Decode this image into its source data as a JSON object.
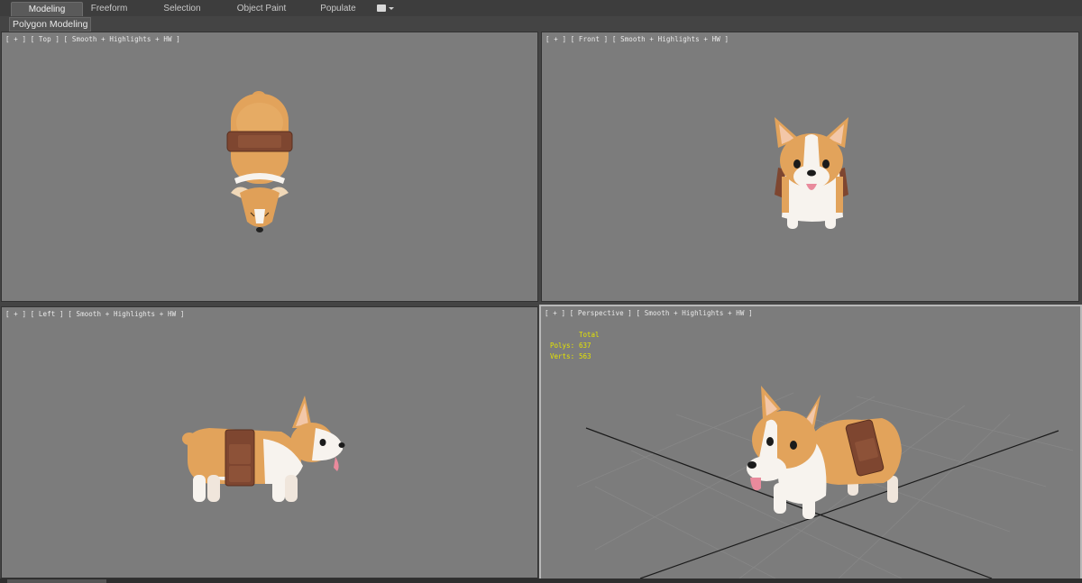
{
  "ribbon": {
    "tabs": [
      "Modeling",
      "Freeform",
      "Selection",
      "Object Paint",
      "Populate"
    ],
    "active_tab": "Modeling",
    "panel_label": "Polygon Modeling"
  },
  "viewports": {
    "top": {
      "label": "[ + ] [ Top ] [ Smooth + Highlights + HW ]"
    },
    "front": {
      "label": "[ + ] [ Front ] [ Smooth + Highlights + HW ]"
    },
    "left": {
      "label": "[ + ] [ Left ] [ Smooth + Highlights + HW ]"
    },
    "perspective": {
      "label": "[ + ] [ Perspective ] [ Smooth + Highlights + HW ]",
      "stats": {
        "header": "Total",
        "polys_label": "Polys:",
        "polys_value": "637",
        "verts_label": "Verts:",
        "verts_value": "563"
      }
    }
  },
  "colors": {
    "viewport_bg": "#7c7c7c",
    "stats_text": "#e4e400",
    "fur": "#e2a35b",
    "fur_light": "#f7f3ee",
    "strap": "#7e4630"
  }
}
